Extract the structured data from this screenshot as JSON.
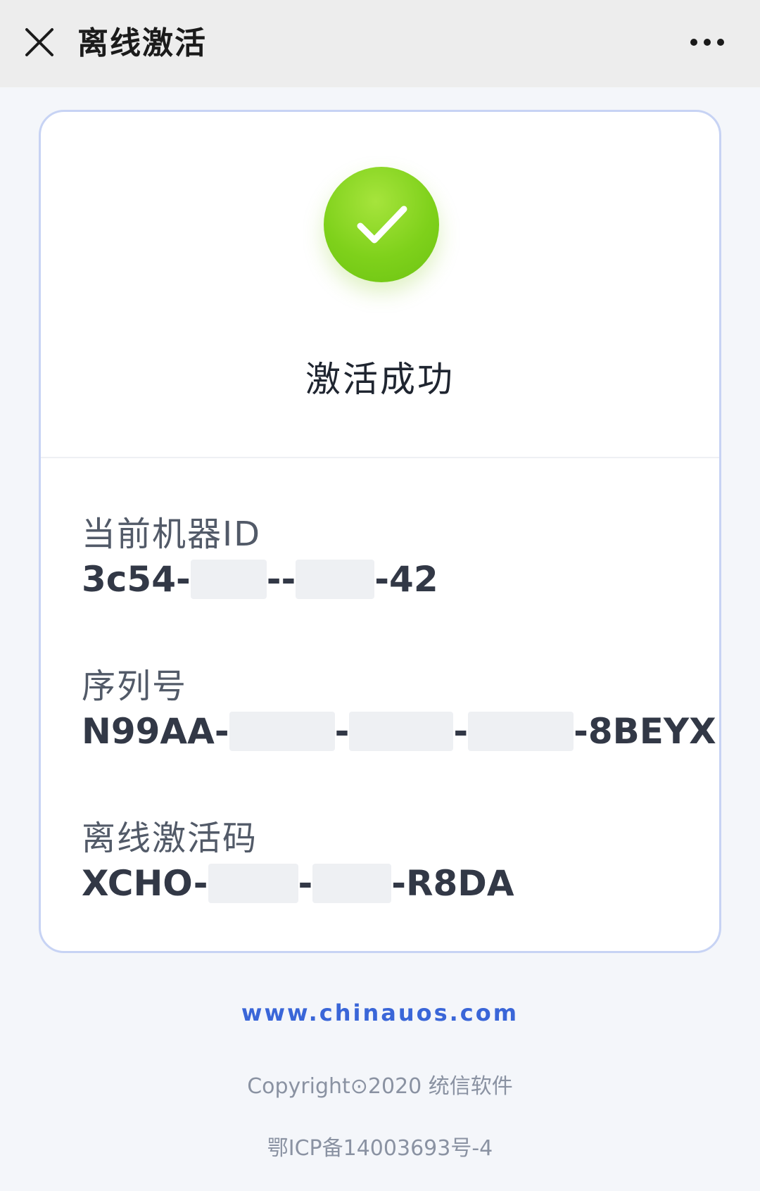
{
  "header": {
    "title": "离线激活",
    "close_icon": "close-icon",
    "more_icon": "more-icon"
  },
  "status": {
    "icon": "check-circle-icon",
    "color": "#7fd11b",
    "text": "激活成功"
  },
  "fields": [
    {
      "label": "当前机器ID",
      "parts": [
        "3c54-",
        "--",
        "-42"
      ]
    },
    {
      "label": "序列号",
      "parts": [
        "N99AA-",
        "-",
        "-",
        "-8BEYX"
      ]
    },
    {
      "label": "离线激活码",
      "parts": [
        "XCHO-",
        "-",
        "-R8DA"
      ]
    }
  ],
  "footer": {
    "link": "www.chinauos.com",
    "copyright": "Copyright⊙2020 统信软件",
    "icp": "鄂ICP备14003693号-4"
  },
  "colors": {
    "link": "#3a66d8",
    "card_border": "#c7d3f4"
  }
}
